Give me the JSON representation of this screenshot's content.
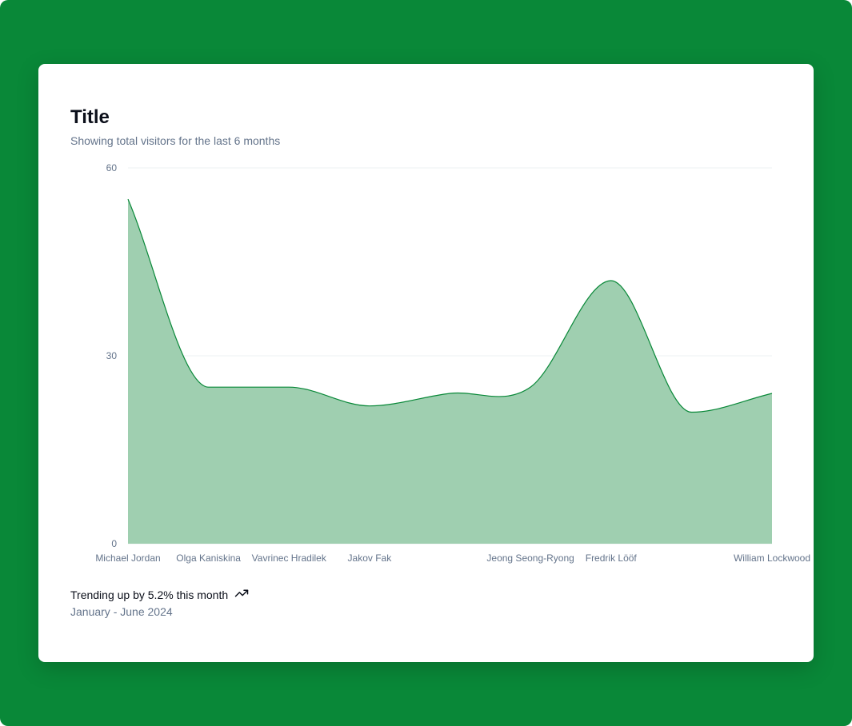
{
  "card": {
    "title": "Title",
    "description": "Showing total visitors for the last 6 months",
    "footer_trend": "Trending up by 5.2% this month",
    "footer_range": "January - June 2024"
  },
  "colors": {
    "background": "#098838",
    "series_stroke": "#098838",
    "series_fill": "#9fcfb0",
    "grid": "#eef0f3",
    "tick_text": "#64748b"
  },
  "icons": {
    "trend": "trending-up-icon"
  },
  "chart_data": {
    "type": "area",
    "title": "Title",
    "x_categories": [
      "Michael Jordan",
      "Olga Kaniskina",
      "Vavrinec Hradilek",
      "Jakov Fak",
      "",
      "Jeong Seong-Ryong",
      "Fredrik Lööf",
      "",
      "William Lockwood"
    ],
    "series": [
      {
        "values": [
          55,
          25,
          25,
          22,
          24,
          25,
          42,
          21,
          24
        ]
      }
    ],
    "y_ticks": [
      0,
      30,
      60
    ],
    "ylim": [
      0,
      60
    ],
    "grid": true,
    "interpolation": "smooth"
  }
}
